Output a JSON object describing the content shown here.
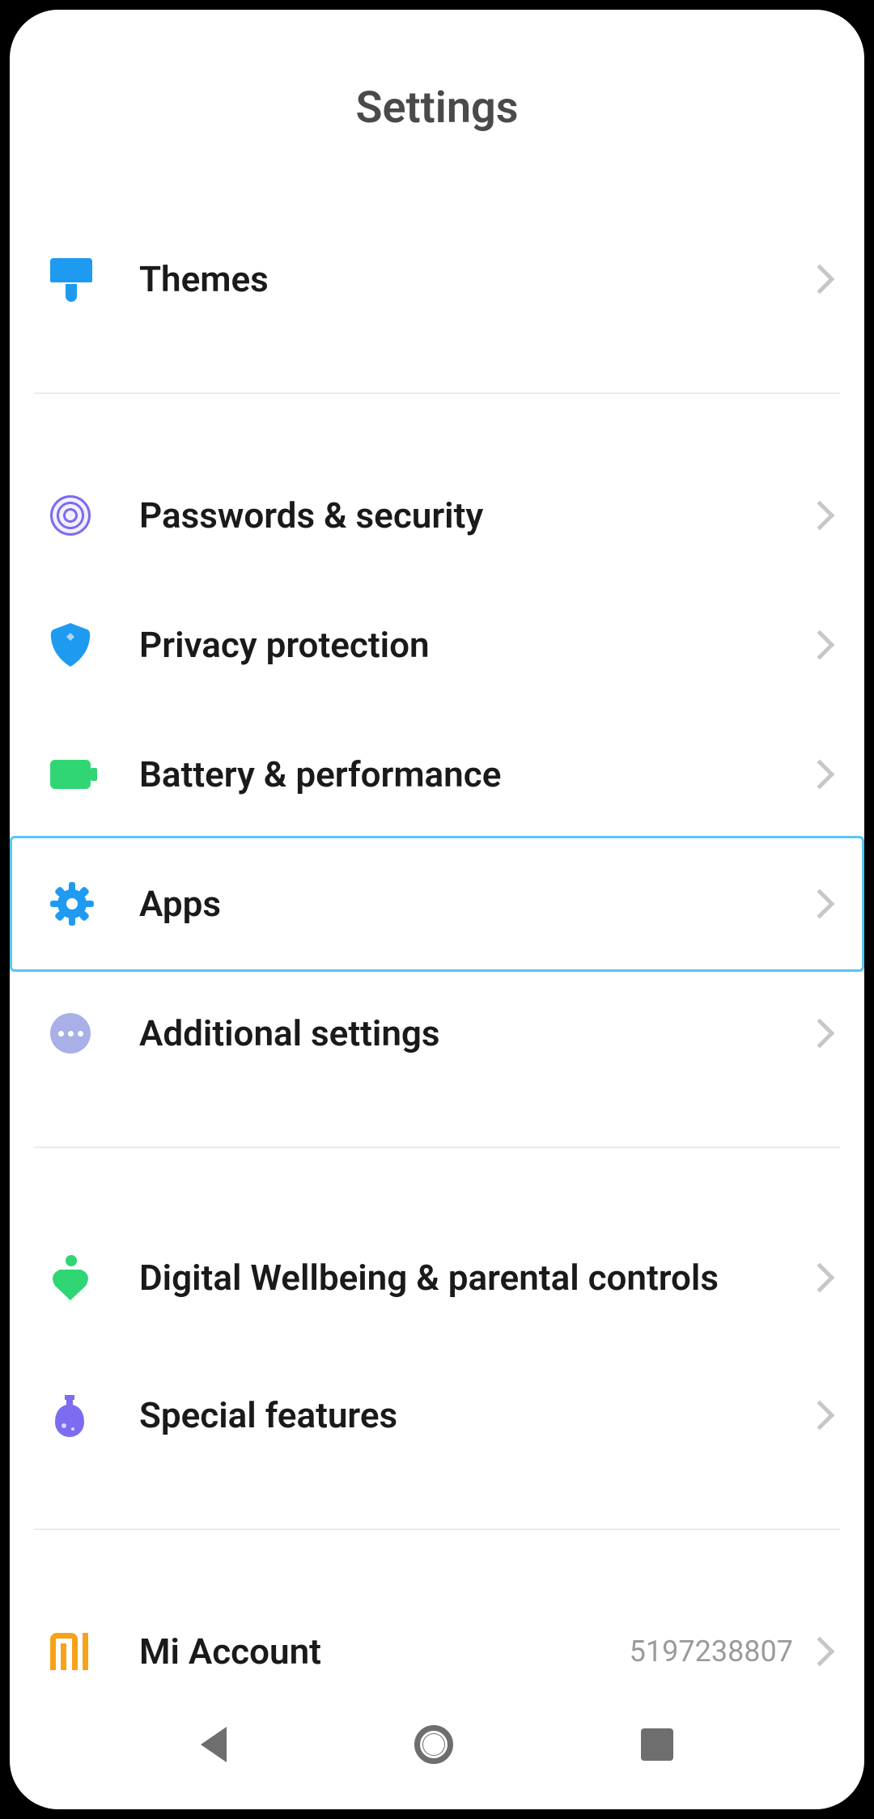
{
  "header": {
    "title": "Settings"
  },
  "groups": [
    {
      "items": [
        {
          "id": "themes",
          "icon": "themes-icon",
          "label": "Themes",
          "highlighted": false
        }
      ]
    },
    {
      "items": [
        {
          "id": "passwords",
          "icon": "fingerprint-icon",
          "label": "Passwords & security",
          "highlighted": false
        },
        {
          "id": "privacy",
          "icon": "shield-icon",
          "label": "Privacy protection",
          "highlighted": false
        },
        {
          "id": "battery",
          "icon": "battery-icon",
          "label": "Battery & performance",
          "highlighted": false
        },
        {
          "id": "apps",
          "icon": "gear-icon",
          "label": "Apps",
          "highlighted": true
        },
        {
          "id": "additional",
          "icon": "ellipsis-icon",
          "label": "Additional settings",
          "highlighted": false
        }
      ]
    },
    {
      "items": [
        {
          "id": "wellbeing",
          "icon": "wellbeing-icon",
          "label": "Digital Wellbeing & parental controls",
          "highlighted": false,
          "tall": true
        },
        {
          "id": "special",
          "icon": "flask-icon",
          "label": "Special features",
          "highlighted": false
        }
      ]
    },
    {
      "items": [
        {
          "id": "miaccount",
          "icon": "mi-icon",
          "label": "Mi Account",
          "value": "5197238807",
          "highlighted": false
        }
      ]
    }
  ],
  "nav": {
    "back": "Back",
    "home": "Home",
    "recent": "Recent"
  }
}
